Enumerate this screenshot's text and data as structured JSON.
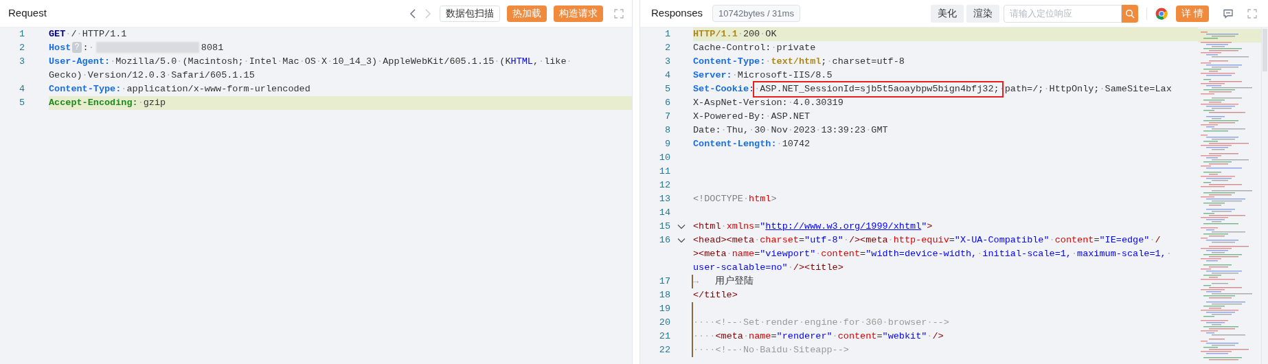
{
  "request": {
    "title": "Request",
    "nav": [
      {
        "kind": "prev",
        "disabled": false
      },
      {
        "kind": "next",
        "disabled": true
      }
    ],
    "buttons": [
      {
        "label": "数据包扫描",
        "kind": "outline"
      },
      {
        "label": "热加载",
        "kind": "primary"
      },
      {
        "label": "构造请求",
        "kind": "primary"
      }
    ],
    "lines": [
      {
        "number": "1",
        "highlighted": false,
        "wraps": [
          {
            "tokens": [
              {
                "kind": "method",
                "text": "GET"
              },
              {
                "kind": "plain",
                "text": "·/·HTTP/1.1"
              }
            ]
          }
        ]
      },
      {
        "number": "2",
        "highlighted": false,
        "wraps": [
          {
            "tokens": [
              {
                "kind": "key",
                "text": "Host"
              },
              {
                "kind": "help",
                "text": "?"
              },
              {
                "kind": "plain",
                "text": ":·"
              },
              {
                "kind": "redacted"
              },
              {
                "kind": "plain",
                "text": "8081"
              }
            ]
          }
        ]
      },
      {
        "number": "3",
        "highlighted": false,
        "wraps": [
          {
            "tokens": [
              {
                "kind": "key",
                "text": "User-Agent:"
              },
              {
                "kind": "plain",
                "text": "·Mozilla/5.0·(Macintosh;·Intel·Mac·OS·X·10_14_3)·AppleWebKit/605.1.15·(K"
              },
              {
                "kind": "string",
                "text": "HTML"
              },
              {
                "kind": "plain",
                "text": ",·like·"
              }
            ]
          },
          {
            "tokens": [
              {
                "kind": "plain",
                "text": "Gecko)·Version/12.0.3·Safari/605.1.15"
              }
            ]
          }
        ]
      },
      {
        "number": "4",
        "highlighted": false,
        "wraps": [
          {
            "tokens": [
              {
                "kind": "key",
                "text": "Content-Type:"
              },
              {
                "kind": "plain",
                "text": "·application/x-www-form-urlencoded"
              }
            ]
          }
        ]
      },
      {
        "number": "5",
        "highlighted": true,
        "wraps": [
          {
            "tokens": [
              {
                "kind": "header",
                "text": "Accept-Encoding:"
              },
              {
                "kind": "plain",
                "text": "·gzip"
              }
            ]
          }
        ]
      }
    ]
  },
  "response": {
    "title": "Responses",
    "stats": "10742bytes / 31ms",
    "buttons": [
      {
        "label": "美化"
      },
      {
        "label": "渲染"
      }
    ],
    "search": {
      "placeholder": "请输入定位响应"
    },
    "detail_button": "详 情",
    "lines": [
      {
        "number": "1",
        "highlighted": true,
        "fold": false,
        "guide": false,
        "wraps": [
          {
            "tokens": [
              {
                "kind": "status",
                "text": "HTTP/1.1"
              },
              {
                "kind": "plain",
                "text": "·200·OK"
              }
            ]
          }
        ]
      },
      {
        "number": "2",
        "highlighted": false,
        "fold": false,
        "guide": false,
        "wraps": [
          {
            "tokens": [
              {
                "kind": "plain",
                "text": "Cache-Control:·private"
              }
            ]
          }
        ]
      },
      {
        "number": "3",
        "highlighted": false,
        "fold": false,
        "guide": false,
        "wraps": [
          {
            "tokens": [
              {
                "kind": "key",
                "text": "Content-Type:"
              },
              {
                "kind": "plain",
                "text": "·"
              },
              {
                "kind": "status",
                "text": "text/html"
              },
              {
                "kind": "plain",
                "text": ";·charset=utf-8"
              }
            ]
          }
        ]
      },
      {
        "number": "4",
        "highlighted": false,
        "fold": false,
        "guide": false,
        "wraps": [
          {
            "tokens": [
              {
                "kind": "key",
                "text": "Server:"
              },
              {
                "kind": "plain",
                "text": "·Microsoft-IIS/8.5"
              }
            ]
          }
        ]
      },
      {
        "number": "5",
        "highlighted": false,
        "fold": false,
        "guide": false,
        "wraps": [
          {
            "tokens": [
              {
                "kind": "key",
                "text": "Set-Cookie:"
              },
              {
                "kind": "plain",
                "text": "·"
              },
              {
                "kind": "boxed",
                "text": "ASP.NET_SessionId=sjb5t5aoaybpw5bign4bfj32;"
              },
              {
                "kind": "plain",
                "text": "·path=/;·HttpOnly;·SameSite=Lax"
              }
            ]
          }
        ]
      },
      {
        "number": "6",
        "highlighted": false,
        "fold": false,
        "guide": false,
        "wraps": [
          {
            "tokens": [
              {
                "kind": "plain",
                "text": "X-AspNet-Version:·4.0.30319"
              }
            ]
          }
        ]
      },
      {
        "number": "7",
        "highlighted": false,
        "fold": false,
        "guide": false,
        "wraps": [
          {
            "tokens": [
              {
                "kind": "plain",
                "text": "X-Powered-By:·ASP.NET"
              }
            ]
          }
        ]
      },
      {
        "number": "8",
        "highlighted": false,
        "fold": false,
        "guide": false,
        "wraps": [
          {
            "tokens": [
              {
                "kind": "plain",
                "text": "Date:·Thu,·30·Nov·2023·13:39:23·GMT"
              }
            ]
          }
        ]
      },
      {
        "number": "9",
        "highlighted": false,
        "fold": false,
        "guide": false,
        "wraps": [
          {
            "tokens": [
              {
                "kind": "key",
                "text": "Content-Length:"
              },
              {
                "kind": "plain",
                "text": "·10742"
              }
            ]
          }
        ]
      },
      {
        "number": "10",
        "highlighted": false,
        "fold": false,
        "guide": false
      },
      {
        "number": "11",
        "highlighted": false,
        "fold": false,
        "guide": false
      },
      {
        "number": "12",
        "highlighted": false,
        "fold": false,
        "guide": false
      },
      {
        "number": "13",
        "highlighted": false,
        "fold": false,
        "guide": false,
        "wraps": [
          {
            "tokens": [
              {
                "kind": "punct",
                "text": "<!DOCTYPE·"
              },
              {
                "kind": "attr",
                "text": "html"
              },
              {
                "kind": "punct",
                "text": ">"
              }
            ]
          }
        ]
      },
      {
        "number": "14",
        "highlighted": false,
        "fold": false,
        "guide": false
      },
      {
        "number": "15",
        "highlighted": false,
        "fold": true,
        "guide": false,
        "wraps": [
          {
            "tokens": [
              {
                "kind": "tag",
                "text": "<html"
              },
              {
                "kind": "plain",
                "text": "·"
              },
              {
                "kind": "attr",
                "text": "xmlns"
              },
              {
                "kind": "plain",
                "text": "="
              },
              {
                "kind": "string",
                "text": "\""
              },
              {
                "kind": "link",
                "text": "http://www.w3.org/1999/xhtml"
              },
              {
                "kind": "string",
                "text": "\""
              },
              {
                "kind": "tag",
                "text": ">"
              }
            ]
          }
        ]
      },
      {
        "number": "16",
        "highlighted": false,
        "fold": true,
        "guide": false,
        "wraps": [
          {
            "tokens": [
              {
                "kind": "tag",
                "text": "<head><meta"
              },
              {
                "kind": "plain",
                "text": "·"
              },
              {
                "kind": "attr",
                "text": "charset"
              },
              {
                "kind": "plain",
                "text": "="
              },
              {
                "kind": "string",
                "text": "\"utf-8\""
              },
              {
                "kind": "plain",
                "text": "·"
              },
              {
                "kind": "tag",
                "text": "/><meta"
              },
              {
                "kind": "plain",
                "text": "·"
              },
              {
                "kind": "attr",
                "text": "http-equiv"
              },
              {
                "kind": "plain",
                "text": "="
              },
              {
                "kind": "string",
                "text": "\"X-UA-Compatible\""
              },
              {
                "kind": "plain",
                "text": "·"
              },
              {
                "kind": "attr",
                "text": "content"
              },
              {
                "kind": "plain",
                "text": "="
              },
              {
                "kind": "string",
                "text": "\"IE=edge\""
              },
              {
                "kind": "plain",
                "text": "·"
              },
              {
                "kind": "tag",
                "text": "/"
              }
            ]
          },
          {
            "tokens": [
              {
                "kind": "tag",
                "text": "><meta"
              },
              {
                "kind": "plain",
                "text": "·"
              },
              {
                "kind": "attr",
                "text": "name"
              },
              {
                "kind": "plain",
                "text": "="
              },
              {
                "kind": "string",
                "text": "\"viewport\""
              },
              {
                "kind": "plain",
                "text": "·"
              },
              {
                "kind": "attr",
                "text": "content"
              },
              {
                "kind": "plain",
                "text": "="
              },
              {
                "kind": "string",
                "text": "\"width=device-width,·initial-scale=1,·maximum-scale=1,·"
              }
            ]
          },
          {
            "tokens": [
              {
                "kind": "string",
                "text": "user-scalable=no\""
              },
              {
                "kind": "plain",
                "text": "·"
              },
              {
                "kind": "tag",
                "text": "/><title>"
              }
            ]
          }
        ]
      },
      {
        "number": "17",
        "highlighted": false,
        "fold": false,
        "guide": true,
        "wraps": [
          {
            "tokens": [
              {
                "kind": "comment",
                "text": "→   "
              },
              {
                "kind": "plain",
                "text": "用户登陆"
              }
            ]
          }
        ]
      },
      {
        "number": "18",
        "highlighted": false,
        "fold": false,
        "guide": false,
        "wraps": [
          {
            "tokens": [
              {
                "kind": "tag",
                "text": "</title>"
              }
            ]
          }
        ]
      },
      {
        "number": "19",
        "highlighted": false,
        "fold": false,
        "guide": true
      },
      {
        "number": "20",
        "highlighted": false,
        "fold": false,
        "guide": true,
        "wraps": [
          {
            "tokens": [
              {
                "kind": "comment",
                "text": "····<!--·Set·render·engine·for·360·browser·-->"
              }
            ]
          }
        ]
      },
      {
        "number": "21",
        "highlighted": false,
        "fold": false,
        "guide": true,
        "wraps": [
          {
            "tokens": [
              {
                "kind": "plain",
                "text": "····"
              },
              {
                "kind": "tag",
                "text": "<meta"
              },
              {
                "kind": "plain",
                "text": "·"
              },
              {
                "kind": "attr",
                "text": "name"
              },
              {
                "kind": "plain",
                "text": "="
              },
              {
                "kind": "string",
                "text": "\"renderer\""
              },
              {
                "kind": "plain",
                "text": "·"
              },
              {
                "kind": "attr",
                "text": "content"
              },
              {
                "kind": "plain",
                "text": "="
              },
              {
                "kind": "string",
                "text": "\"webkit\""
              },
              {
                "kind": "plain",
                "text": "·"
              },
              {
                "kind": "tag",
                "text": "/>"
              }
            ]
          }
        ]
      },
      {
        "number": "22",
        "highlighted": false,
        "fold": false,
        "guide": true,
        "wraps": [
          {
            "tokens": [
              {
                "kind": "comment",
                "text": "····<!--·No·Baidu·Siteapp-->"
              }
            ]
          }
        ]
      }
    ]
  }
}
